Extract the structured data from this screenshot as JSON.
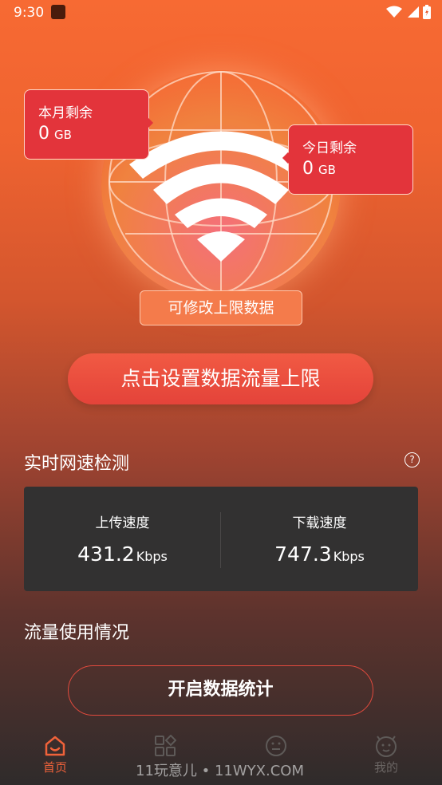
{
  "status_bar": {
    "time": "9:30"
  },
  "month_remaining": {
    "label": "本月剩余",
    "value": "0",
    "unit": "GB"
  },
  "today_remaining": {
    "label": "今日剩余",
    "value": "0",
    "unit": "GB"
  },
  "edit_limit_label": "可修改上限数据",
  "set_limit_button": "点击设置数据流量上限",
  "speed_section": {
    "title": "实时网速检测",
    "help": "?",
    "upload_label": "上传速度",
    "upload_value": "431.2",
    "upload_unit": "Kbps",
    "download_label": "下载速度",
    "download_value": "747.3",
    "download_unit": "Kbps"
  },
  "usage_section": {
    "title": "流量使用情况",
    "button": "开启数据统计"
  },
  "nav": {
    "items": [
      {
        "label": "首页",
        "icon": "home-icon",
        "active": true
      },
      {
        "label": "",
        "icon": "apps-icon",
        "active": false
      },
      {
        "label": "",
        "icon": "face-icon",
        "active": false
      },
      {
        "label": "我的",
        "icon": "profile-icon",
        "active": false
      }
    ]
  },
  "watermark": "11玩意儿 • 11WYX.COM",
  "colors": {
    "accent": "#e3343b",
    "active_nav": "#f0623a",
    "card": "#323131"
  }
}
